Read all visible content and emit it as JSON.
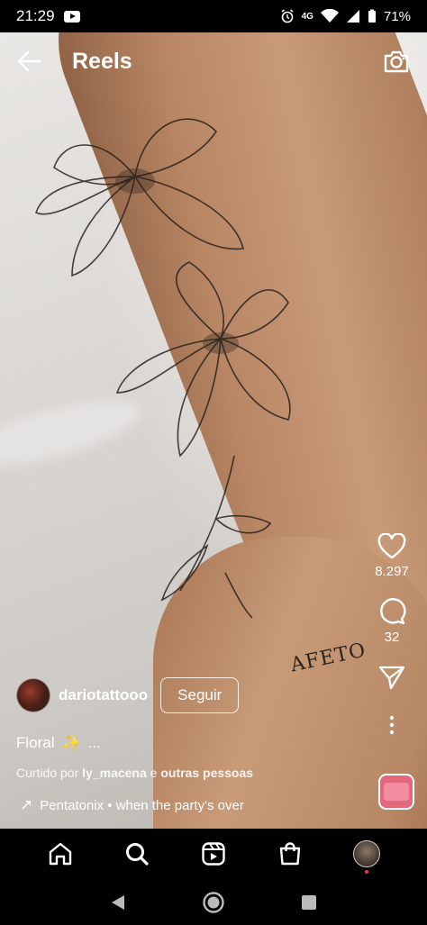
{
  "status_bar": {
    "time": "21:29",
    "network": "4G",
    "battery": "71%"
  },
  "header": {
    "title": "Reels"
  },
  "reel": {
    "tattoo_text": "AFETO"
  },
  "actions": {
    "likes": "8.297",
    "comments": "32"
  },
  "post": {
    "username": "dariotattooo",
    "follow_label": "Seguir",
    "caption": "Floral",
    "caption_sparkle": "✨",
    "caption_more": "...",
    "liked_prefix": "Curtido por ",
    "liked_user": "ly_macena",
    "liked_middle": " e ",
    "liked_others": "outras pessoas",
    "music_arrow": "↗",
    "music": "Pentatonix • when the party's over"
  },
  "icons": {
    "back": "arrow-left-icon",
    "camera": "camera-icon",
    "like": "heart-icon",
    "comment": "comment-icon",
    "share": "send-icon",
    "more": "more-vertical-icon",
    "home": "home-icon",
    "search": "search-icon",
    "reels": "reels-icon",
    "shop": "shop-icon"
  }
}
